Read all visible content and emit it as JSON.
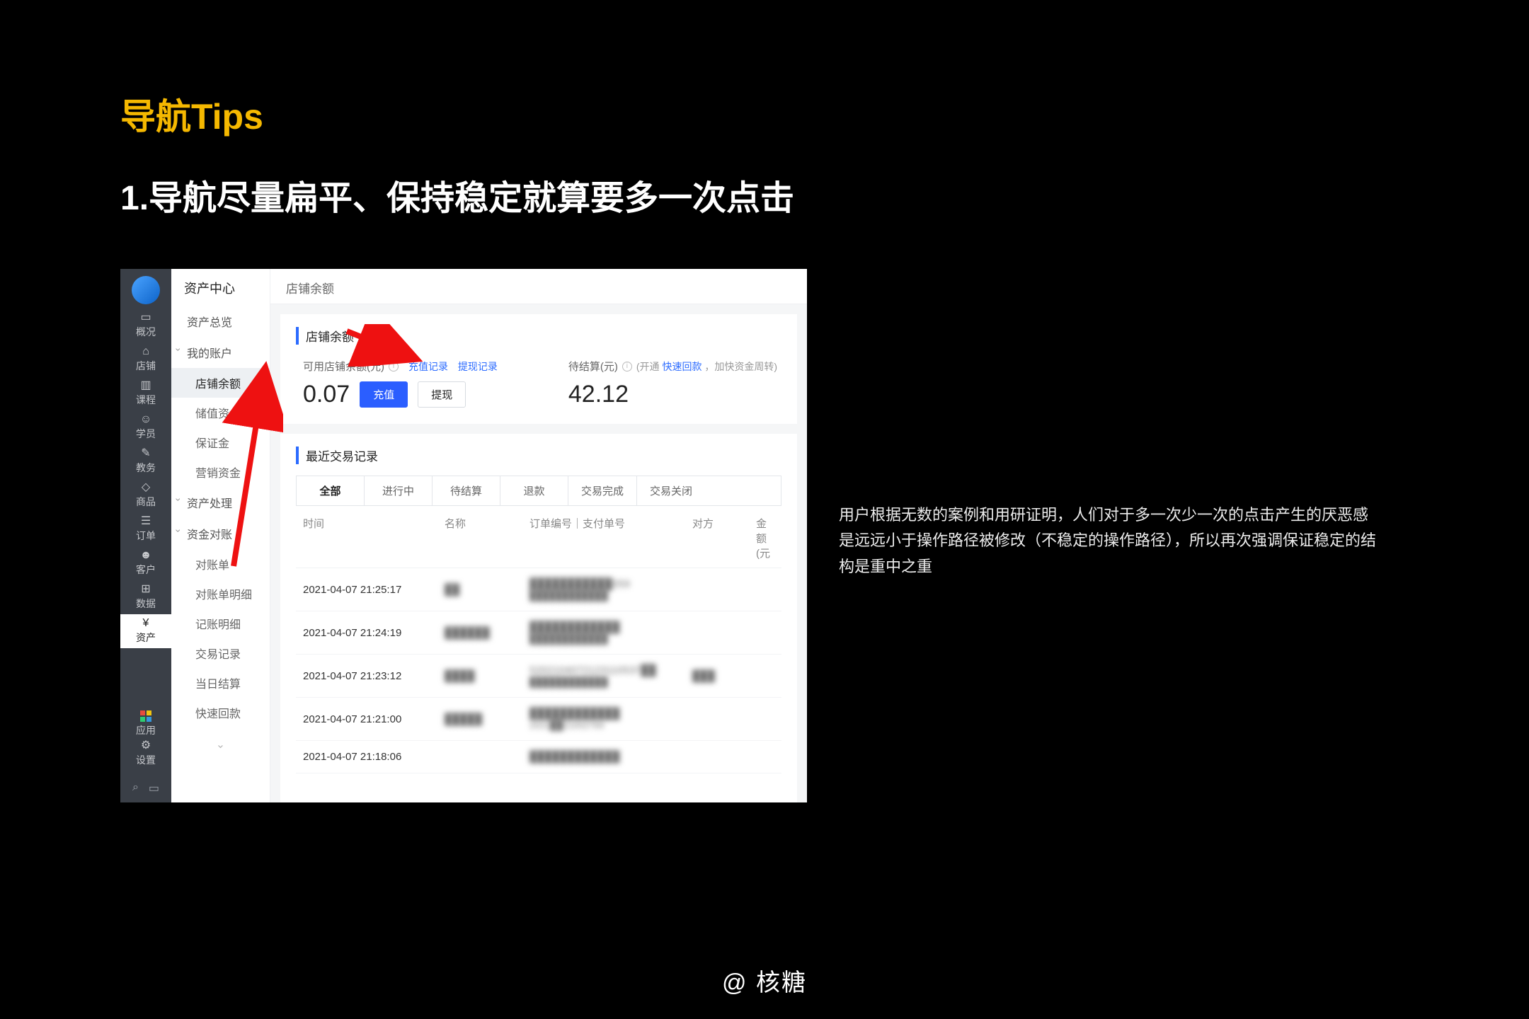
{
  "slide": {
    "title": "导航Tips",
    "heading": "1.导航尽量扁平、保持稳定就算要多一次点击",
    "description": "用户根据无数的案例和用研证明，人们对于多一次少一次的点击产生的厌恶感是远远小于操作路径被修改（不稳定的操作路径），所以再次强调保证稳定的结构是重中之重",
    "footer": "@ 核糖"
  },
  "rail": {
    "items": [
      {
        "icon": "▭",
        "label": "概况"
      },
      {
        "icon": "⌂",
        "label": "店铺"
      },
      {
        "icon": "▥",
        "label": "课程"
      },
      {
        "icon": "☺",
        "label": "学员"
      },
      {
        "icon": "✎",
        "label": "教务"
      },
      {
        "icon": "◇",
        "label": "商品"
      },
      {
        "icon": "☰",
        "label": "订单"
      },
      {
        "icon": "☻",
        "label": "客户"
      },
      {
        "icon": "⊞",
        "label": "数据"
      },
      {
        "icon": "¥",
        "label": "资产"
      }
    ],
    "active_index": 9,
    "apps_label": "应用",
    "settings_label": "设置"
  },
  "subnav": {
    "title": "资产中心",
    "overview": "资产总览",
    "groups": [
      {
        "label": "我的账户",
        "items": [
          {
            "label": "店铺余额",
            "active": true
          },
          {
            "label": "储值资金"
          },
          {
            "label": "保证金"
          },
          {
            "label": "营销资金"
          }
        ]
      },
      {
        "label": "资产处理",
        "items": []
      },
      {
        "label": "资金对账",
        "items": [
          {
            "label": "对账单"
          },
          {
            "label": "对账单明细"
          },
          {
            "label": "记账明细"
          },
          {
            "label": "交易记录"
          }
        ]
      }
    ],
    "extra": [
      {
        "label": "当日结算"
      },
      {
        "label": "快速回款"
      }
    ]
  },
  "main": {
    "breadcrumb": "店铺余额",
    "balance_panel": {
      "title": "店铺余额",
      "available_label": "可用店铺余额(元)",
      "link_recharge_log": "充值记录",
      "link_withdraw_log": "提现记录",
      "available_value": "0.07",
      "btn_recharge": "充值",
      "btn_withdraw": "提现",
      "pending_label": "待结算(元)",
      "pending_hint_prefix": "(开通",
      "pending_hint_link": "快速回款",
      "pending_hint_suffix": "，加快资金周转)",
      "pending_value": "42.12"
    },
    "tx_panel": {
      "title": "最近交易记录",
      "tabs": [
        "全部",
        "进行中",
        "待结算",
        "退款",
        "交易完成",
        "交易关闭"
      ],
      "active_tab": 0,
      "columns": {
        "time": "时间",
        "name": "名称",
        "order": "订单编号｜支付单号",
        "party": "对方",
        "amount": "金额(元"
      },
      "rows": [
        {
          "time": "2021-04-07 21:25:17",
          "name": "██",
          "order_a": "███████████059",
          "order_b": "████████████",
          "party": "",
          "amount": ""
        },
        {
          "time": "2021-04-07 21:24:19",
          "name": "██████",
          "order_a": "████████████",
          "order_b": "████████████",
          "party": "",
          "amount": ""
        },
        {
          "time": "2021-04-07 21:23:12",
          "name": "████",
          "order_a": "5202104072123110537██",
          "order_b": "████████████",
          "party": "███",
          "amount": ""
        },
        {
          "time": "2021-04-07 21:21:00",
          "name": "█████",
          "order_a": "████████████",
          "order_b": "2021██21002769",
          "party": "",
          "amount": ""
        },
        {
          "time": "2021-04-07 21:18:06",
          "name": "",
          "order_a": "████████████",
          "order_b": "",
          "party": "",
          "amount": ""
        }
      ]
    }
  }
}
